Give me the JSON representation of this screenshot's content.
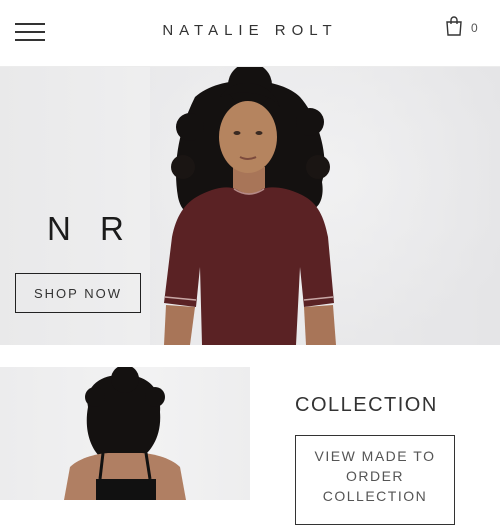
{
  "header": {
    "brand": "NATALIE ROLT",
    "cart_count": "0",
    "menu_icon": "hamburger-menu-icon",
    "cart_icon": "shopping-bag-icon"
  },
  "hero": {
    "monogram": "N R",
    "cta_label": "SHOP NOW",
    "image_subject": "model in burgundy short-sleeve top"
  },
  "collection": {
    "title": "COLLECTION",
    "cta_label": "VIEW MADE TO ORDER COLLECTION",
    "image_subject": "model back view in black top"
  },
  "colors": {
    "garment": "#5a2224",
    "hair": "#141110",
    "skin": "#b07f63",
    "background": "#ebebec"
  }
}
